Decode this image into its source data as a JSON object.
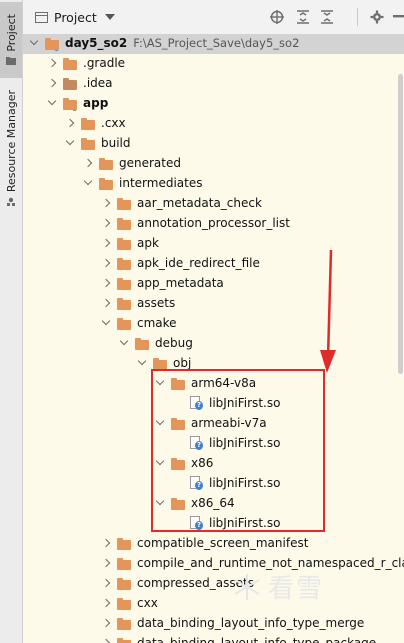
{
  "side": {
    "project_tab": "Project",
    "resource_tab": "Resource Manager"
  },
  "header": {
    "title": "Project",
    "buttons": [
      "target-icon",
      "expand-all-icon",
      "collapse-all-icon",
      "settings-icon",
      "hide-icon"
    ]
  },
  "tree": [
    {
      "indent": 0,
      "arrow": "down",
      "icon": "module-folder",
      "label": "day5_so2",
      "bold": true,
      "path": "F:\\AS_Project_Save\\day5_so2",
      "selected": true
    },
    {
      "indent": 1,
      "arrow": "right",
      "icon": "folder",
      "label": ".gradle"
    },
    {
      "indent": 1,
      "arrow": "right",
      "icon": "folder-plain",
      "label": ".idea"
    },
    {
      "indent": 1,
      "arrow": "down",
      "icon": "module-folder",
      "label": "app",
      "bold": true
    },
    {
      "indent": 2,
      "arrow": "right",
      "icon": "folder",
      "label": ".cxx"
    },
    {
      "indent": 2,
      "arrow": "down",
      "icon": "folder",
      "label": "build"
    },
    {
      "indent": 3,
      "arrow": "right",
      "icon": "folder",
      "label": "generated"
    },
    {
      "indent": 3,
      "arrow": "down",
      "icon": "folder",
      "label": "intermediates"
    },
    {
      "indent": 4,
      "arrow": "right",
      "icon": "folder",
      "label": "aar_metadata_check"
    },
    {
      "indent": 4,
      "arrow": "right",
      "icon": "folder",
      "label": "annotation_processor_list"
    },
    {
      "indent": 4,
      "arrow": "right",
      "icon": "folder",
      "label": "apk"
    },
    {
      "indent": 4,
      "arrow": "right",
      "icon": "folder",
      "label": "apk_ide_redirect_file"
    },
    {
      "indent": 4,
      "arrow": "right",
      "icon": "folder",
      "label": "app_metadata"
    },
    {
      "indent": 4,
      "arrow": "right",
      "icon": "folder",
      "label": "assets"
    },
    {
      "indent": 4,
      "arrow": "down",
      "icon": "folder",
      "label": "cmake"
    },
    {
      "indent": 5,
      "arrow": "down",
      "icon": "folder",
      "label": "debug"
    },
    {
      "indent": 6,
      "arrow": "down",
      "icon": "folder",
      "label": "obj"
    },
    {
      "indent": 7,
      "arrow": "down",
      "icon": "folder",
      "label": "arm64-v8a"
    },
    {
      "indent": 8,
      "arrow": "none",
      "icon": "so-file",
      "label": "libJniFirst.so"
    },
    {
      "indent": 7,
      "arrow": "down",
      "icon": "folder",
      "label": "armeabi-v7a"
    },
    {
      "indent": 8,
      "arrow": "none",
      "icon": "so-file",
      "label": "libJniFirst.so"
    },
    {
      "indent": 7,
      "arrow": "down",
      "icon": "folder",
      "label": "x86"
    },
    {
      "indent": 8,
      "arrow": "none",
      "icon": "so-file",
      "label": "libJniFirst.so"
    },
    {
      "indent": 7,
      "arrow": "down",
      "icon": "folder",
      "label": "x86_64"
    },
    {
      "indent": 8,
      "arrow": "none",
      "icon": "so-file",
      "label": "libJniFirst.so"
    },
    {
      "indent": 4,
      "arrow": "right",
      "icon": "folder",
      "label": "compatible_screen_manifest"
    },
    {
      "indent": 4,
      "arrow": "right",
      "icon": "folder",
      "label": "compile_and_runtime_not_namespaced_r_class"
    },
    {
      "indent": 4,
      "arrow": "right",
      "icon": "folder",
      "label": "compressed_assets"
    },
    {
      "indent": 4,
      "arrow": "right",
      "icon": "folder",
      "label": "cxx"
    },
    {
      "indent": 4,
      "arrow": "right",
      "icon": "folder",
      "label": "data_binding_layout_info_type_merge"
    },
    {
      "indent": 4,
      "arrow": "right",
      "icon": "folder",
      "label": "data_binding_layout_info_type_package"
    }
  ],
  "annotation": {
    "color": "#e02b2b"
  },
  "watermark": {
    "text": "看雪"
  }
}
